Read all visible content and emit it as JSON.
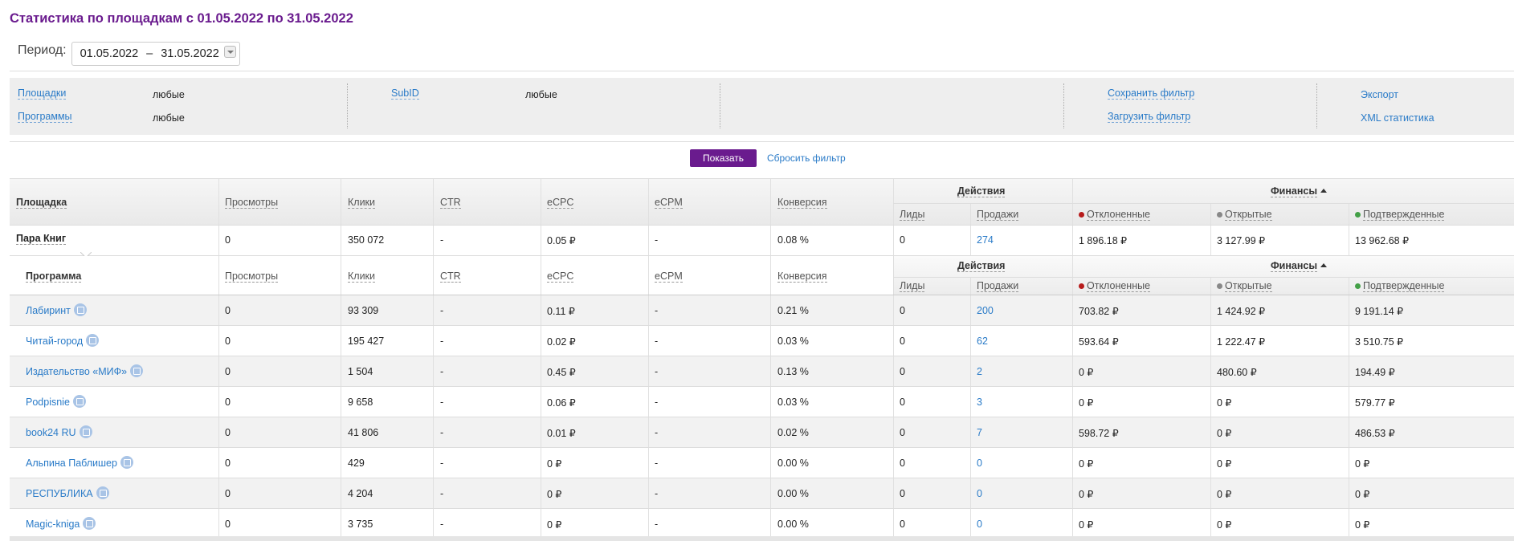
{
  "title": "Статистика по площадкам с 01.05.2022 по 31.05.2022",
  "period": {
    "label": "Период:",
    "from": "01.05.2022",
    "sep": "–",
    "to": "31.05.2022"
  },
  "filters": {
    "platforms_label": "Площадки",
    "platforms_value": "любые",
    "programs_label": "Программы",
    "programs_value": "любые",
    "subid_label": "SubID",
    "subid_value": "любые",
    "save_filter": "Сохранить фильтр",
    "load_filter": "Загрузить фильтр",
    "export": "Экспорт",
    "xml": "XML статистика"
  },
  "buttons": {
    "show": "Показать",
    "reset": "Сбросить фильтр"
  },
  "header": {
    "platform": "Площадка",
    "program": "Программа",
    "views": "Просмотры",
    "clicks": "Клики",
    "ctr": "CTR",
    "ecpc": "eCPC",
    "ecpm": "eCPM",
    "conversion": "Конверсия",
    "actions": "Действия",
    "leads": "Лиды",
    "sales": "Продажи",
    "finance": "Финансы",
    "rejected": "Отклоненные",
    "open": "Открытые",
    "confirmed": "Подтвержденные"
  },
  "colors": {
    "rejected": "#b71c1c",
    "open": "#888888",
    "confirmed": "#43a047",
    "brand": "#6a1b8e",
    "link": "#2a7bc8"
  },
  "summary": {
    "name": "Пара Книг",
    "views": "0",
    "clicks": "350 072",
    "ctr": "-",
    "ecpc": "0.05 ₽",
    "ecpm": "-",
    "conversion": "0.08 %",
    "leads": "0",
    "sales": "274",
    "rejected": "1 896.18 ₽",
    "open": "3 127.99 ₽",
    "confirmed": "13 962.68 ₽"
  },
  "rows": [
    {
      "name": "Лабиринт",
      "views": "0",
      "clicks": "93 309",
      "ctr": "-",
      "ecpc": "0.11 ₽",
      "ecpm": "-",
      "conversion": "0.21 %",
      "leads": "0",
      "sales": "200",
      "rejected": "703.82 ₽",
      "open": "1 424.92 ₽",
      "confirmed": "9 191.14 ₽"
    },
    {
      "name": "Читай-город",
      "views": "0",
      "clicks": "195 427",
      "ctr": "-",
      "ecpc": "0.02 ₽",
      "ecpm": "-",
      "conversion": "0.03 %",
      "leads": "0",
      "sales": "62",
      "rejected": "593.64 ₽",
      "open": "1 222.47 ₽",
      "confirmed": "3 510.75 ₽"
    },
    {
      "name": "Издательство «МИФ»",
      "views": "0",
      "clicks": "1 504",
      "ctr": "-",
      "ecpc": "0.45 ₽",
      "ecpm": "-",
      "conversion": "0.13 %",
      "leads": "0",
      "sales": "2",
      "rejected": "0 ₽",
      "open": "480.60 ₽",
      "confirmed": "194.49 ₽"
    },
    {
      "name": "Podpisnie",
      "views": "0",
      "clicks": "9 658",
      "ctr": "-",
      "ecpc": "0.06 ₽",
      "ecpm": "-",
      "conversion": "0.03 %",
      "leads": "0",
      "sales": "3",
      "rejected": "0 ₽",
      "open": "0 ₽",
      "confirmed": "579.77 ₽"
    },
    {
      "name": "book24 RU",
      "views": "0",
      "clicks": "41 806",
      "ctr": "-",
      "ecpc": "0.01 ₽",
      "ecpm": "-",
      "conversion": "0.02 %",
      "leads": "0",
      "sales": "7",
      "rejected": "598.72 ₽",
      "open": "0 ₽",
      "confirmed": "486.53 ₽"
    },
    {
      "name": "Альпина Паблишер",
      "views": "0",
      "clicks": "429",
      "ctr": "-",
      "ecpc": "0 ₽",
      "ecpm": "-",
      "conversion": "0.00 %",
      "leads": "0",
      "sales": "0",
      "rejected": "0 ₽",
      "open": "0 ₽",
      "confirmed": "0 ₽"
    },
    {
      "name": "РЕСПУБЛИКА",
      "views": "0",
      "clicks": "4 204",
      "ctr": "-",
      "ecpc": "0 ₽",
      "ecpm": "-",
      "conversion": "0.00 %",
      "leads": "0",
      "sales": "0",
      "rejected": "0 ₽",
      "open": "0 ₽",
      "confirmed": "0 ₽"
    },
    {
      "name": "Magic-kniga",
      "views": "0",
      "clicks": "3 735",
      "ctr": "-",
      "ecpc": "0 ₽",
      "ecpm": "-",
      "conversion": "0.00 %",
      "leads": "0",
      "sales": "0",
      "rejected": "0 ₽",
      "open": "0 ₽",
      "confirmed": "0 ₽"
    }
  ]
}
